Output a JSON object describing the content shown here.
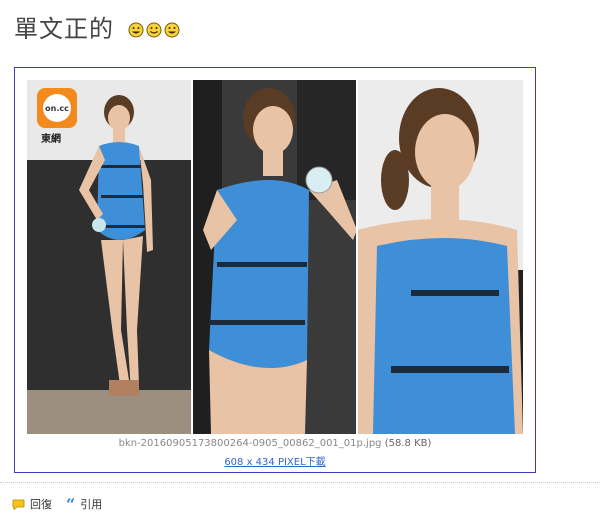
{
  "post": {
    "title": "單文正的",
    "emoticons": [
      "grin-emoticon",
      "smile-emoticon",
      "grin-emoticon"
    ]
  },
  "attachment": {
    "watermark_caption": "東網",
    "watermark_logo_text": "on.cc",
    "filename": "bkn-20160905173800264-0905_00862_001_01p.jpg",
    "filesize": "(58.8 KB)",
    "download_label": "608 x 434 PIXEL下載"
  },
  "actions": {
    "reply_label": "回復",
    "quote_label": "引用"
  },
  "colors": {
    "frame_border": "#3b3bbf",
    "link": "#3366cc",
    "logo_orange": "#f28a1e",
    "swimsuit_blue": "#3f8fd8"
  }
}
